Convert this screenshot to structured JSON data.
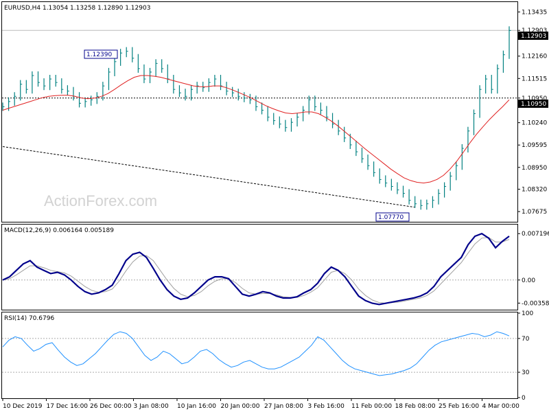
{
  "main": {
    "header": "EURUSD,H4  1.13054 1.13258 1.12890 1.12903",
    "watermark": "ActionForex.com",
    "current_price": "1.12903",
    "level_price": "1.10950",
    "label_high": "1.12390",
    "label_low": "1.07770"
  },
  "macd_panel": {
    "header": "MACD(12,26,9) 0.006164 0.005189"
  },
  "rsi_panel": {
    "header": "RSI(14) 70.6796"
  },
  "colors": {
    "bars": "#008080",
    "ma": "#e02020",
    "macd": "#00008b",
    "signal": "#a0a0a0",
    "rsi": "#1e90ff",
    "label_border": "#00008b"
  },
  "chart_data": [
    {
      "type": "line",
      "title": "EURUSD,H4",
      "ylim": [
        1.074,
        1.137
      ],
      "y_ticks": [
        "1.13435",
        "1.12903",
        "1.12160",
        "1.11515",
        "1.10950",
        "1.10240",
        "1.09595",
        "1.08950",
        "1.08320",
        "1.07675"
      ],
      "y_tick_values": [
        1.13435,
        1.12903,
        1.1216,
        1.11515,
        1.1095,
        1.1024,
        1.09595,
        1.0895,
        1.0832,
        1.07675
      ],
      "x_ticks": [
        "10 Dec 2019",
        "17 Dec 16:00",
        "26 Dec 00:00",
        "3 Jan 08:00",
        "10 Jan 16:00",
        "20 Jan 00:00",
        "27 Jan 08:00",
        "3 Feb 16:00",
        "11 Feb 00:00",
        "18 Feb 08:00",
        "25 Feb 16:00",
        "4 Mar 00:00"
      ],
      "series": [
        {
          "role": "price",
          "close": [
            1.107,
            1.1085,
            1.11,
            1.1135,
            1.112,
            1.116,
            1.114,
            1.113,
            1.115,
            1.114,
            1.112,
            1.1115,
            1.11,
            1.108,
            1.1085,
            1.109,
            1.11,
            1.113,
            1.117,
            1.12,
            1.1225,
            1.123,
            1.121,
            1.118,
            1.115,
            1.117,
            1.1195,
            1.118,
            1.115,
            1.112,
            1.111,
            1.11,
            1.112,
            1.113,
            1.1125,
            1.114,
            1.115,
            1.113,
            1.1115,
            1.111,
            1.11,
            1.1095,
            1.109,
            1.107,
            1.106,
            1.104,
            1.103,
            1.102,
            1.101,
            1.1025,
            1.104,
            1.106,
            1.109,
            1.107,
            1.106,
            1.104,
            1.102,
            1.1,
            1.098,
            1.096,
            1.094,
            1.092,
            1.09,
            1.088,
            1.086,
            1.085,
            1.084,
            1.083,
            1.082,
            1.08,
            1.079,
            1.0785,
            1.079,
            1.08,
            1.082,
            1.084,
            1.087,
            1.09,
            1.095,
            1.1,
            1.105,
            1.112,
            1.115,
            1.112,
            1.118,
            1.122,
            1.129
          ]
        },
        {
          "role": "moving_average",
          "values": [
            1.106,
            1.1066,
            1.1072,
            1.1078,
            1.1084,
            1.109,
            1.1096,
            1.11,
            1.1102,
            1.1103,
            1.1103,
            1.11,
            1.1095,
            1.1093,
            1.1095,
            1.11,
            1.1108,
            1.112,
            1.1133,
            1.1145,
            1.1155,
            1.116,
            1.116,
            1.1158,
            1.1155,
            1.115,
            1.1145,
            1.114,
            1.1135,
            1.113,
            1.1128,
            1.1128,
            1.113,
            1.113,
            1.1125,
            1.1118,
            1.111,
            1.1102,
            1.1093,
            1.1083,
            1.1073,
            1.1065,
            1.1058,
            1.1052,
            1.105,
            1.1052,
            1.1055,
            1.1055,
            1.105,
            1.104,
            1.1028,
            1.1014,
            1.0998,
            1.0982,
            1.0966,
            1.095,
            1.0935,
            1.092,
            1.0905,
            1.089,
            1.0877,
            1.0865,
            1.0857,
            1.0852,
            1.085,
            1.0853,
            1.086,
            1.0872,
            1.089,
            1.0912,
            1.0938,
            1.0965,
            1.099,
            1.1012,
            1.1033,
            1.1052,
            1.107,
            1.109
          ]
        },
        {
          "role": "trendline",
          "values": [
            1.0955,
            1.078
          ]
        }
      ]
    },
    {
      "type": "line",
      "title": "MACD(12,26,9)",
      "ylim": [
        -0.0045,
        0.0085
      ],
      "y_ticks": [
        "0.007196",
        "0.00",
        "-0.003585"
      ],
      "y_tick_values": [
        0.007196,
        0.0,
        -0.003585
      ],
      "series": [
        {
          "name": "MACD",
          "values": [
            0.0,
            0.0005,
            0.0015,
            0.0025,
            0.003,
            0.002,
            0.0015,
            0.001,
            0.0012,
            0.0008,
            0.0,
            -0.001,
            -0.0018,
            -0.0022,
            -0.002,
            -0.0015,
            -0.0008,
            0.001,
            0.003,
            0.004,
            0.0043,
            0.0035,
            0.0018,
            0.0,
            -0.0015,
            -0.0025,
            -0.003,
            -0.0028,
            -0.002,
            -0.001,
            0.0,
            0.0005,
            0.0005,
            0.0002,
            -0.001,
            -0.0022,
            -0.0025,
            -0.0022,
            -0.0018,
            -0.002,
            -0.0025,
            -0.0028,
            -0.0028,
            -0.0026,
            -0.002,
            -0.0015,
            -0.0005,
            0.001,
            0.002,
            0.0015,
            0.0005,
            -0.001,
            -0.0025,
            -0.0032,
            -0.0036,
            -0.0038,
            -0.0036,
            -0.0034,
            -0.0032,
            -0.003,
            -0.0028,
            -0.0025,
            -0.002,
            -0.001,
            0.0005,
            0.0015,
            0.0025,
            0.0035,
            0.0055,
            0.0068,
            0.0072,
            0.0065,
            0.005,
            0.006,
            0.0068
          ]
        },
        {
          "name": "Signal",
          "values": [
            0.0,
            0.0002,
            0.0008,
            0.0015,
            0.0022,
            0.0022,
            0.0019,
            0.0015,
            0.0013,
            0.0011,
            0.0006,
            -0.0002,
            -0.001,
            -0.0016,
            -0.0019,
            -0.0018,
            -0.0014,
            -0.0002,
            0.0014,
            0.0028,
            0.0037,
            0.0038,
            0.003,
            0.0015,
            0.0,
            -0.0013,
            -0.0022,
            -0.0026,
            -0.0024,
            -0.0018,
            -0.0009,
            -0.0002,
            0.0002,
            0.0002,
            -0.0004,
            -0.0013,
            -0.002,
            -0.0022,
            -0.0021,
            -0.0021,
            -0.0023,
            -0.0026,
            -0.0027,
            -0.0027,
            -0.0024,
            -0.0019,
            -0.0012,
            0.0,
            0.0012,
            0.0015,
            0.001,
            0.0,
            -0.0014,
            -0.0024,
            -0.0031,
            -0.0035,
            -0.0036,
            -0.0035,
            -0.0034,
            -0.0032,
            -0.003,
            -0.0028,
            -0.0024,
            -0.0017,
            -0.0006,
            0.0005,
            0.0016,
            0.0027,
            0.0042,
            0.0056,
            0.0065,
            0.0066,
            0.0059,
            0.0059,
            0.0063
          ]
        }
      ]
    },
    {
      "type": "line",
      "title": "RSI(14)",
      "ylim": [
        0,
        100
      ],
      "y_ticks": [
        "100",
        "70",
        "30",
        "0"
      ],
      "y_tick_values": [
        100,
        70,
        30,
        0
      ],
      "levels": [
        70,
        30
      ],
      "series": [
        {
          "name": "RSI(14)",
          "values": [
            60,
            68,
            72,
            70,
            62,
            55,
            58,
            63,
            65,
            56,
            48,
            42,
            38,
            40,
            46,
            52,
            60,
            68,
            75,
            78,
            76,
            70,
            60,
            50,
            44,
            48,
            55,
            52,
            46,
            40,
            42,
            48,
            55,
            57,
            52,
            45,
            40,
            36,
            38,
            42,
            44,
            40,
            36,
            34,
            34,
            36,
            40,
            44,
            48,
            55,
            62,
            72,
            68,
            60,
            52,
            44,
            38,
            34,
            32,
            30,
            28,
            26,
            27,
            28,
            30,
            32,
            35,
            40,
            48,
            56,
            62,
            66,
            68,
            70,
            72,
            74,
            76,
            75,
            72,
            74,
            78,
            76,
            73
          ]
        }
      ]
    }
  ]
}
